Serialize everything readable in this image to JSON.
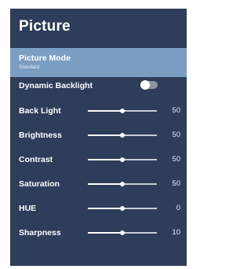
{
  "panel": {
    "title": "Picture"
  },
  "picture_mode": {
    "label": "Picture Mode",
    "value": "Standard"
  },
  "dynamic_backlight": {
    "label": "Dynamic Backlight",
    "enabled": false
  },
  "settings": [
    {
      "label": "Back Light",
      "value": "50",
      "fraction": 0.5
    },
    {
      "label": "Brightness",
      "value": "50",
      "fraction": 0.5
    },
    {
      "label": "Contrast",
      "value": "50",
      "fraction": 0.5
    },
    {
      "label": "Saturation",
      "value": "50",
      "fraction": 0.5
    },
    {
      "label": "HUE",
      "value": "0",
      "fraction": 0.5
    },
    {
      "label": "Sharpness",
      "value": "10",
      "fraction": 0.5
    }
  ],
  "colors": {
    "panel_bg": "#2d3d5a",
    "selected_bg": "#7a9ec2",
    "text": "#ffffff"
  },
  "icons": {
    "toggle": "toggle-switch-off"
  }
}
